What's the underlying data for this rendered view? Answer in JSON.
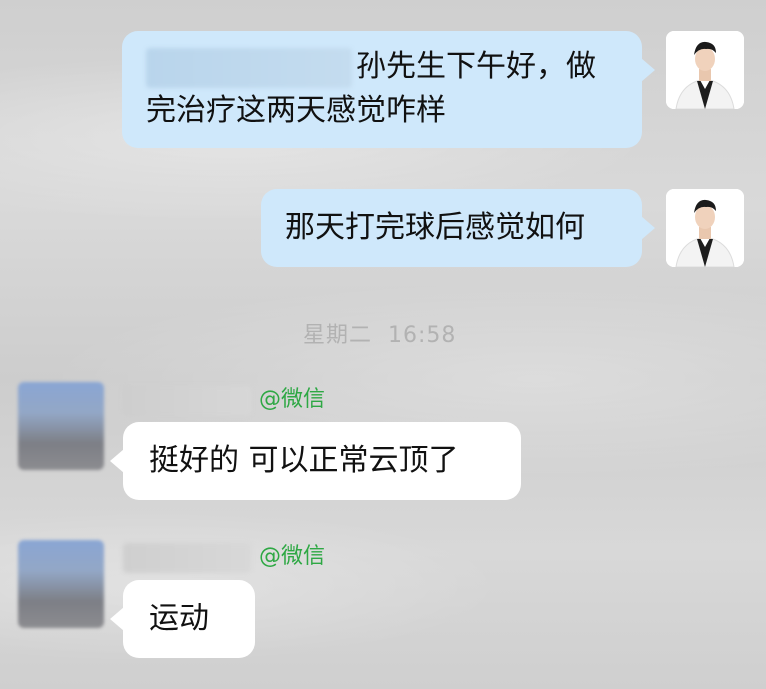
{
  "messages": {
    "m1": {
      "text": "孙先生下午好，做完治疗这两天感觉咋样"
    },
    "m2": {
      "text": "那天打完球后感觉如何"
    },
    "m3": {
      "text": "挺好的 可以正常云顶了"
    },
    "m4": {
      "text": "运动"
    }
  },
  "timestamp": {
    "day": "星期二",
    "time": "16:58"
  },
  "sender": {
    "source_tag": "@微信"
  },
  "colors": {
    "outgoing_bubble": "#cfe8fb",
    "incoming_bubble": "#ffffff",
    "source_tag": "#2ea844",
    "timestamp": "#b2b2b2"
  },
  "icons": {
    "my_avatar": "doctor-avatar-icon",
    "contact_avatar": "blurred-avatar-icon"
  }
}
